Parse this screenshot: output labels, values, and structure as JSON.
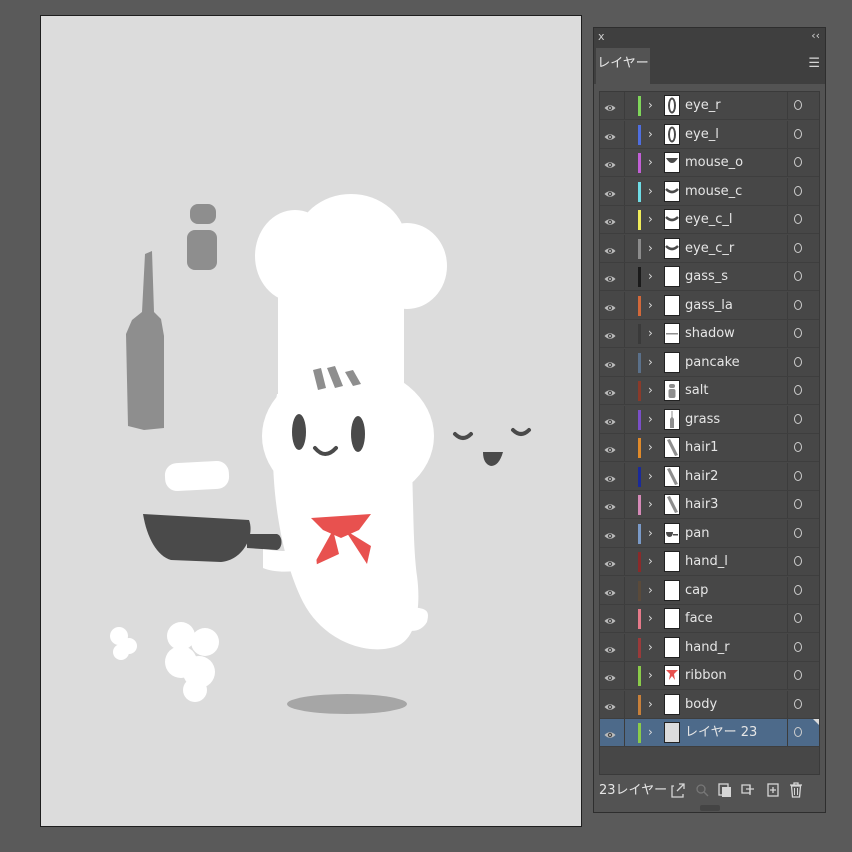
{
  "panel": {
    "close_label": "x",
    "collapse_label": "‹‹",
    "tab_label": "レイヤー",
    "menu_icon": "hamburger-menu-icon",
    "footer_count": "23レイヤー"
  },
  "layers": [
    {
      "name": "eye_r",
      "color": "#7fd65a",
      "thumb": "eye"
    },
    {
      "name": "eye_l",
      "color": "#4f6ee0",
      "thumb": "eye"
    },
    {
      "name": "mouse_o",
      "color": "#c25fd6",
      "thumb": "mouth"
    },
    {
      "name": "mouse_c",
      "color": "#6fdde6",
      "thumb": "curve"
    },
    {
      "name": "eye_c_l",
      "color": "#f0ec5a",
      "thumb": "curve"
    },
    {
      "name": "eye_c_r",
      "color": "#8c8c8c",
      "thumb": "curve"
    },
    {
      "name": "gass_s",
      "color": "#1a1a1a",
      "thumb": "blank"
    },
    {
      "name": "gass_la",
      "color": "#d2683a",
      "thumb": "blank"
    },
    {
      "name": "shadow",
      "color": "#3a3a3a",
      "thumb": "line"
    },
    {
      "name": "pancake",
      "color": "#5a708a",
      "thumb": "blank"
    },
    {
      "name": "salt",
      "color": "#8a3a2a",
      "thumb": "salt"
    },
    {
      "name": "grass",
      "color": "#7a4fc8",
      "thumb": "bottle"
    },
    {
      "name": "hair1",
      "color": "#e08a2a",
      "thumb": "hair"
    },
    {
      "name": "hair2",
      "color": "#1a2a9a",
      "thumb": "hair"
    },
    {
      "name": "hair3",
      "color": "#d68ab8",
      "thumb": "hair"
    },
    {
      "name": "pan",
      "color": "#7a9ac8",
      "thumb": "pan"
    },
    {
      "name": "hand_l",
      "color": "#8a2a2a",
      "thumb": "blank"
    },
    {
      "name": "cap",
      "color": "#5a4a3a",
      "thumb": "blank"
    },
    {
      "name": "face",
      "color": "#e67a8a",
      "thumb": "blank"
    },
    {
      "name": "hand_r",
      "color": "#9a3a3a",
      "thumb": "blank"
    },
    {
      "name": "ribbon",
      "color": "#8acb4a",
      "thumb": "ribbon"
    },
    {
      "name": "body",
      "color": "#c8803a",
      "thumb": "blank"
    },
    {
      "name": "レイヤー 23",
      "color": "#8acb4a",
      "thumb": "gray",
      "selected": true
    }
  ],
  "footer_icons": [
    "export-icon",
    "search-icon",
    "clipping-mask-icon",
    "new-sublayer-icon",
    "new-layer-icon",
    "delete-icon"
  ],
  "colors": {
    "artboard": "#dcdcdc",
    "ribbon_red": "#e8514f",
    "dark_gray": "#4a4a4a",
    "mid_gray": "#8e8e8e",
    "selection": "#4d6a8a"
  }
}
